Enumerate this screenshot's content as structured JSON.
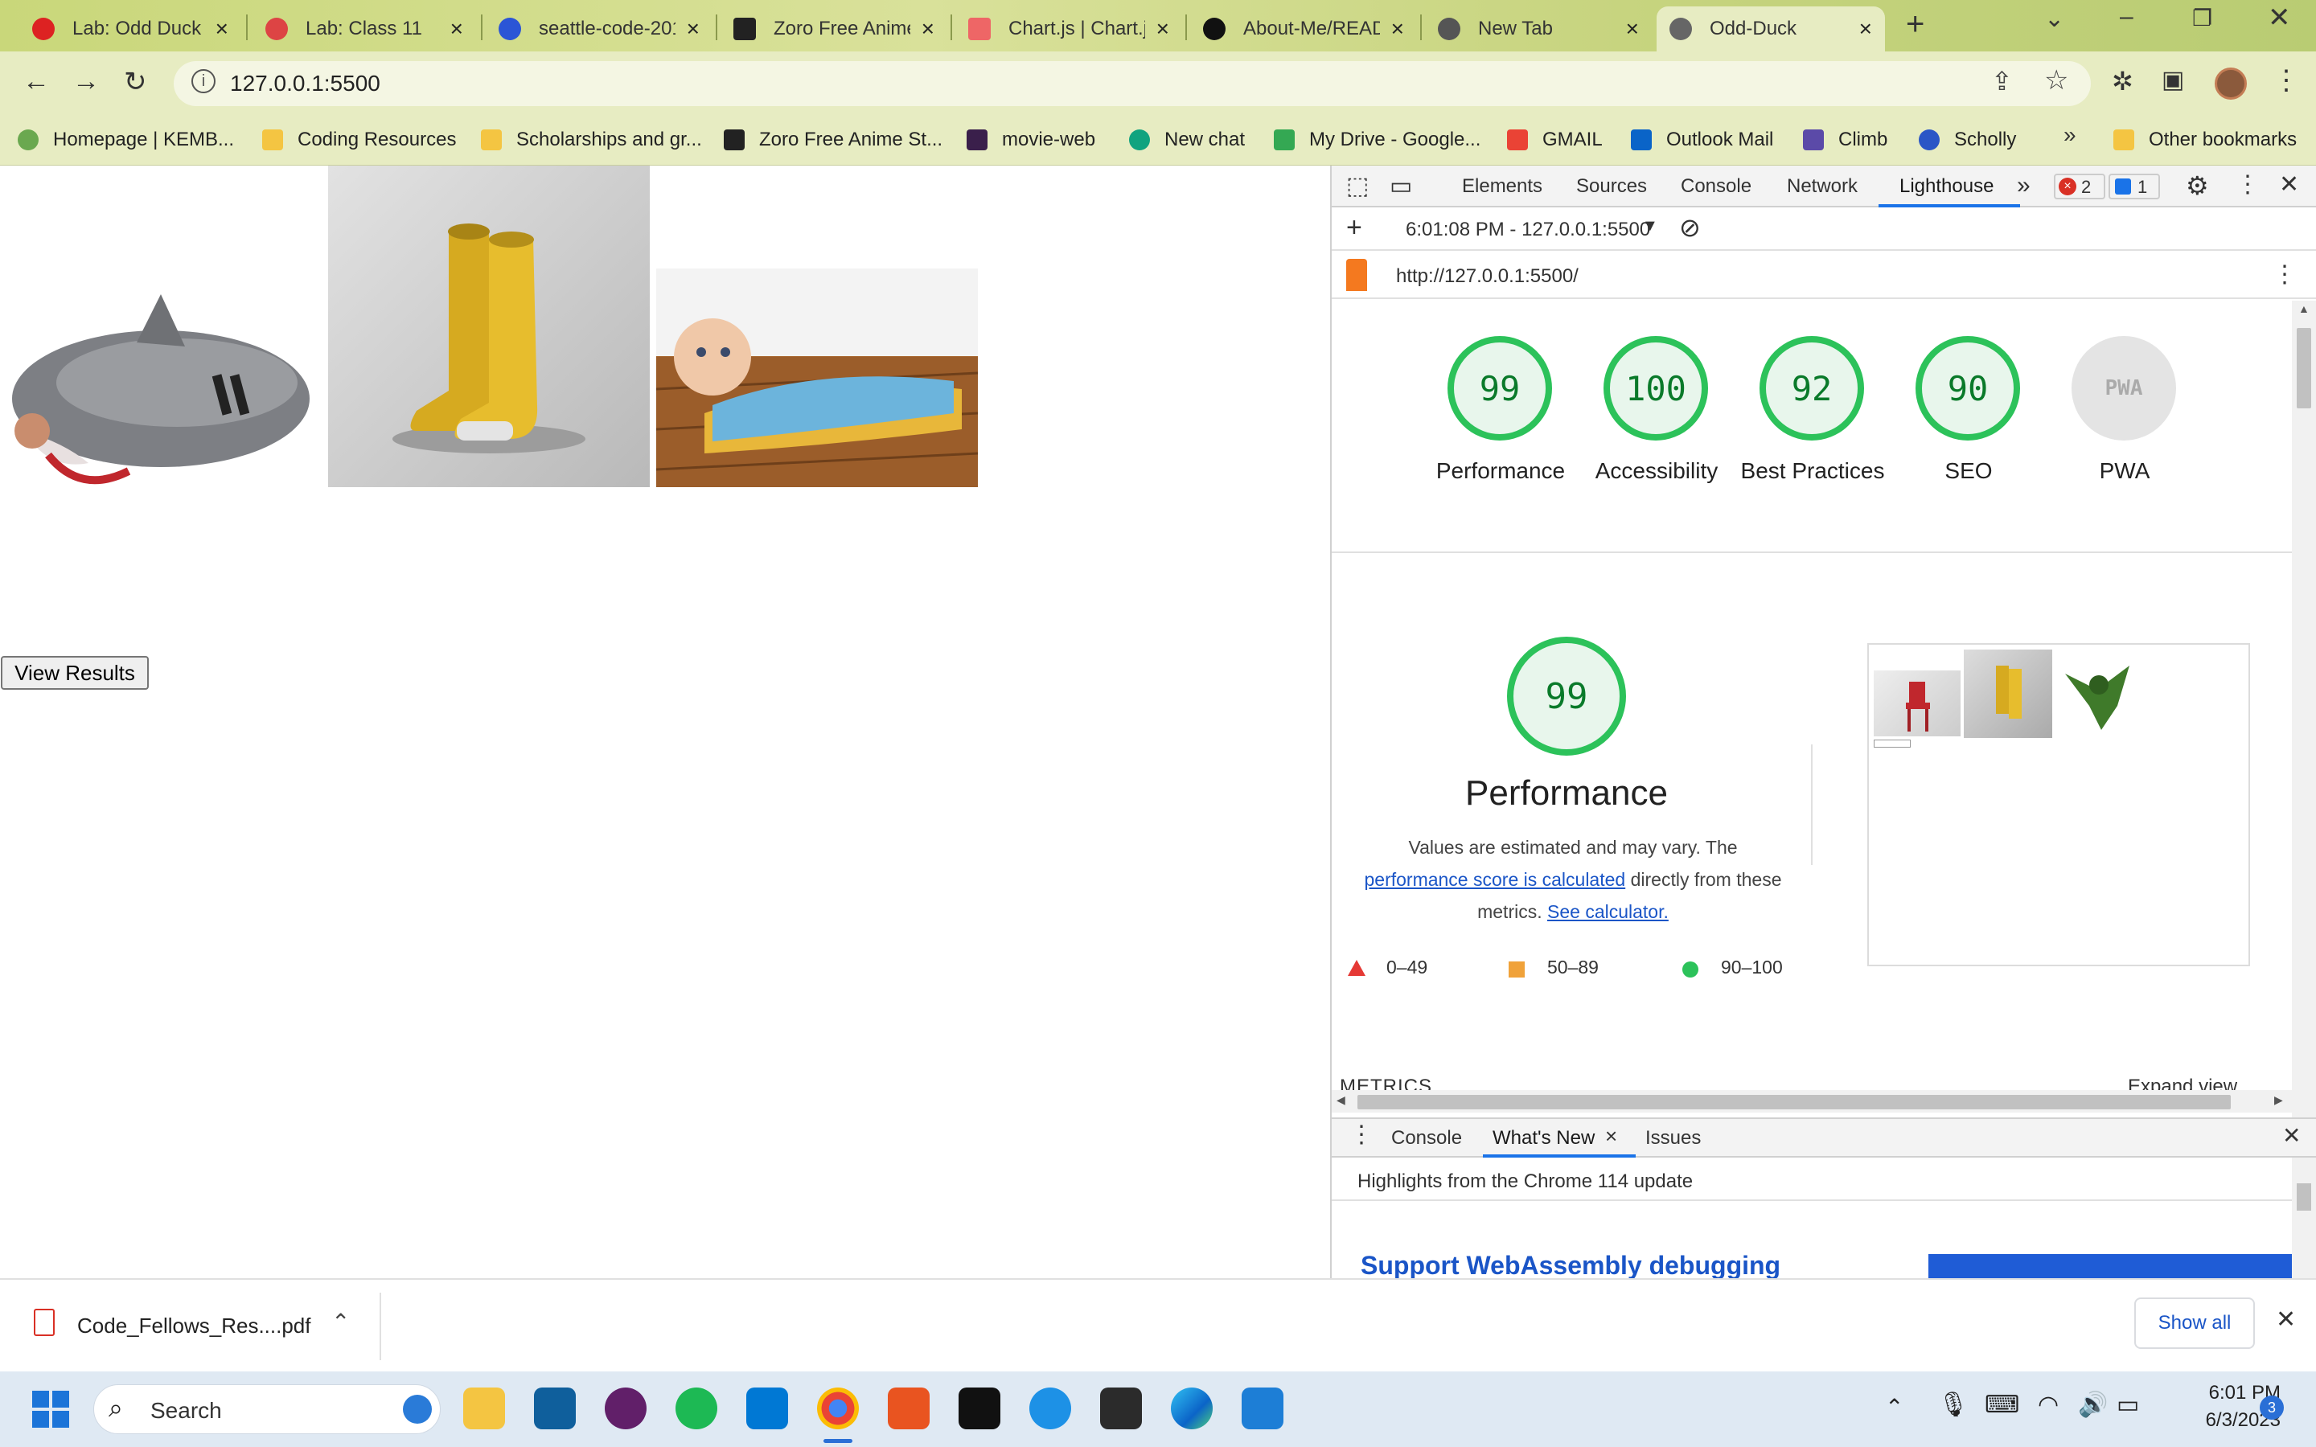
{
  "browser": {
    "tabs": [
      {
        "title": "Lab: Odd Duck",
        "color": "#d22"
      },
      {
        "title": "Lab: Class 11",
        "color": "#d44"
      },
      {
        "title": "seattle-code-201",
        "color": "#2b55d6"
      },
      {
        "title": "Zoro Free Anime",
        "color": "#222"
      },
      {
        "title": "Chart.js | Chart.js",
        "color": "#e66"
      },
      {
        "title": "About-Me/README",
        "color": "#111"
      },
      {
        "title": "New Tab",
        "color": "#555"
      },
      {
        "title": "Odd-Duck",
        "color": "#666"
      }
    ],
    "url": "127.0.0.1:5500",
    "bookmarks": [
      "Homepage | KEMB...",
      "Coding Resources",
      "Scholarships and gr...",
      "Zoro Free Anime St...",
      "movie-web",
      "New chat",
      "My Drive - Google...",
      "GMAIL",
      "Outlook Mail",
      "Climb",
      "Scholly",
      "Other bookmarks"
    ]
  },
  "page": {
    "view_results": "View Results",
    "images": [
      "shark-sleeping-bag-image",
      "yellow-boots-image",
      "baby-sweeper-image"
    ]
  },
  "devtools": {
    "tabs": [
      "Elements",
      "Sources",
      "Console",
      "Network",
      "Lighthouse"
    ],
    "error_count": "2",
    "message_count": "1",
    "report_time": "6:01:08 PM - 127.0.0.1:5500",
    "report_url": "http://127.0.0.1:5500/",
    "scores": [
      {
        "value": "99",
        "label": "Performance"
      },
      {
        "value": "100",
        "label": "Accessibility"
      },
      {
        "value": "92",
        "label": "Best Practices"
      },
      {
        "value": "90",
        "label": "SEO"
      },
      {
        "value": "PWA",
        "label": "PWA"
      }
    ],
    "perf": {
      "score": "99",
      "title": "Performance",
      "desc1": "Values are estimated and may vary. The",
      "link1": "performance score is calculated",
      "desc2": " directly from these",
      "desc3": "metrics. ",
      "link2": "See calculator.",
      "legend": [
        "0–49",
        "50–89",
        "90–100"
      ]
    },
    "metrics_heading": "METRICS",
    "expand_view": "Expand view",
    "drawer_tabs": [
      "Console",
      "What's New",
      "Issues"
    ],
    "drawer_headline": "Highlights from the Chrome 114 update",
    "drawer_article": "Support WebAssembly debugging"
  },
  "download": {
    "file": "Code_Fellows_Res....pdf",
    "show_all": "Show all"
  },
  "taskbar": {
    "search": "Search",
    "time": "6:01 PM",
    "date": "6/3/2023",
    "badge": "3"
  }
}
